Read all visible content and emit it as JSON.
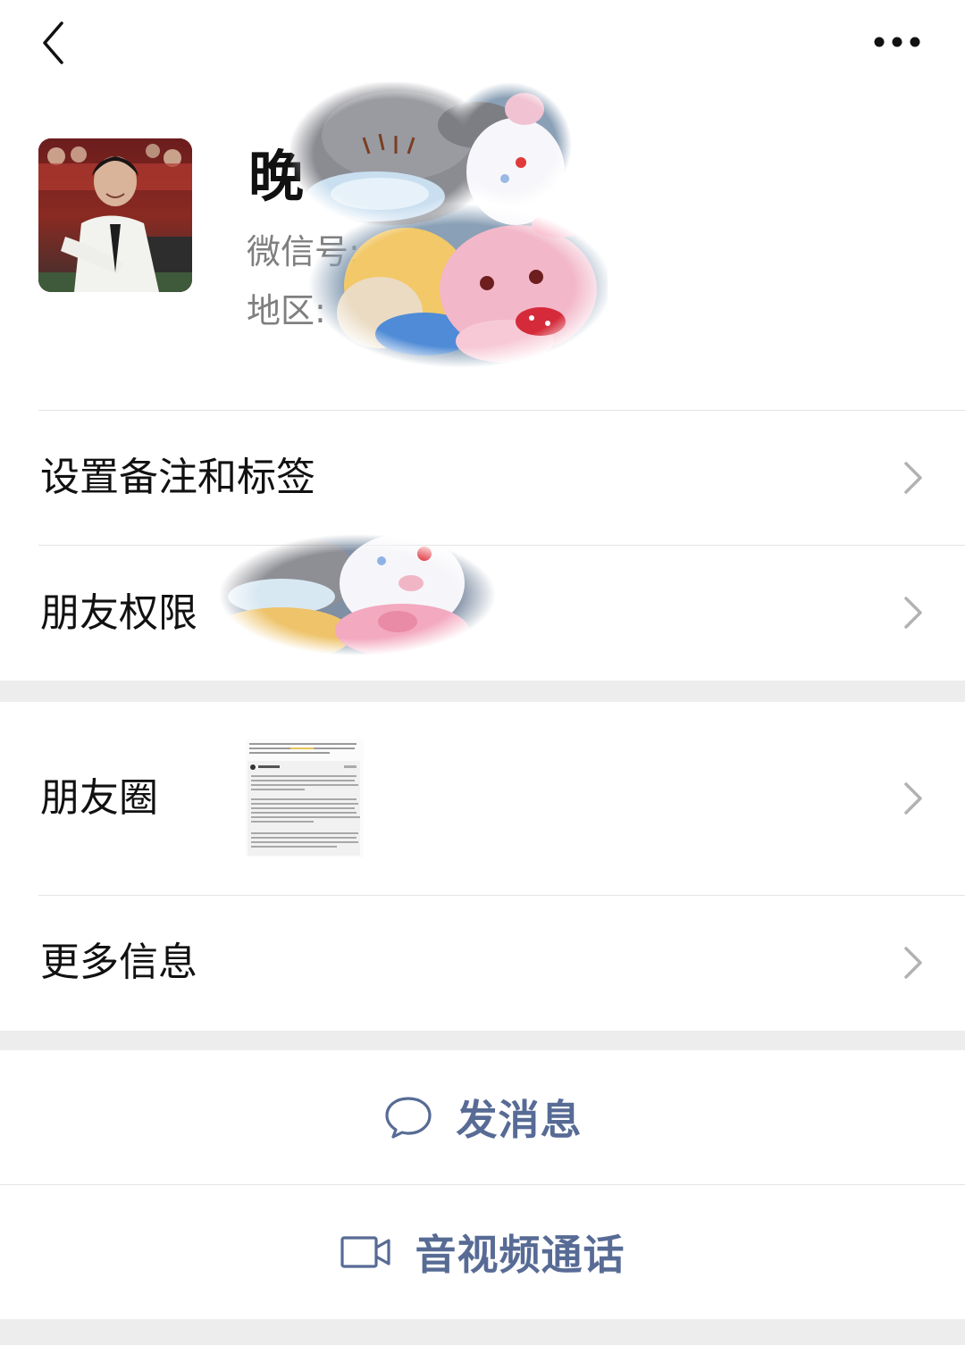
{
  "header": {
    "back_icon": "chevron-left-icon",
    "more_icon": "more-horizontal-icon"
  },
  "profile": {
    "display_name": "晚",
    "wechat_id_label": "微信号:",
    "region_label": "地区:"
  },
  "menu": {
    "remark_tags": "设置备注和标签",
    "friend_permissions": "朋友权限",
    "moments": "朋友圈",
    "more_info": "更多信息"
  },
  "actions": {
    "send_message": "发消息",
    "av_call": "音视频通话"
  },
  "colors": {
    "accent": "#576b95",
    "background": "#ededed",
    "card": "#ffffff",
    "secondary_text": "#7f7f7f"
  }
}
